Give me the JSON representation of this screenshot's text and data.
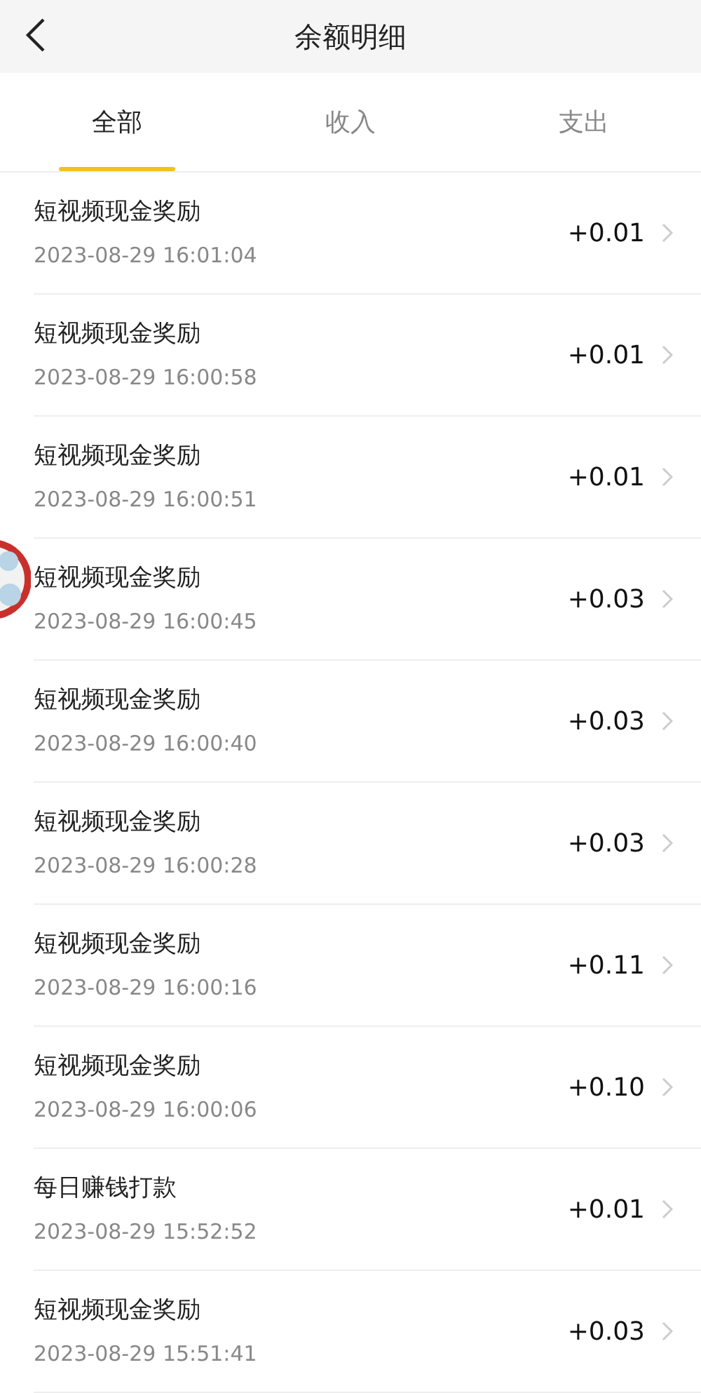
{
  "header": {
    "title": "余额明细"
  },
  "tabs": [
    {
      "label": "全部",
      "selected": true
    },
    {
      "label": "收入",
      "selected": false
    },
    {
      "label": "支出",
      "selected": false
    }
  ],
  "transactions": [
    {
      "title": "短视频现金奖励",
      "time": "2023-08-29 16:01:04",
      "amount": "+0.01"
    },
    {
      "title": "短视频现金奖励",
      "time": "2023-08-29 16:00:58",
      "amount": "+0.01"
    },
    {
      "title": "短视频现金奖励",
      "time": "2023-08-29 16:00:51",
      "amount": "+0.01"
    },
    {
      "title": "短视频现金奖励",
      "time": "2023-08-29 16:00:45",
      "amount": "+0.03"
    },
    {
      "title": "短视频现金奖励",
      "time": "2023-08-29 16:00:40",
      "amount": "+0.03"
    },
    {
      "title": "短视频现金奖励",
      "time": "2023-08-29 16:00:28",
      "amount": "+0.03"
    },
    {
      "title": "短视频现金奖励",
      "time": "2023-08-29 16:00:16",
      "amount": "+0.11"
    },
    {
      "title": "短视频现金奖励",
      "time": "2023-08-29 16:00:06",
      "amount": "+0.10"
    },
    {
      "title": "每日赚钱打款",
      "time": "2023-08-29 15:52:52",
      "amount": "+0.01"
    },
    {
      "title": "短视频现金奖励",
      "time": "2023-08-29 15:51:41",
      "amount": "+0.03"
    }
  ]
}
